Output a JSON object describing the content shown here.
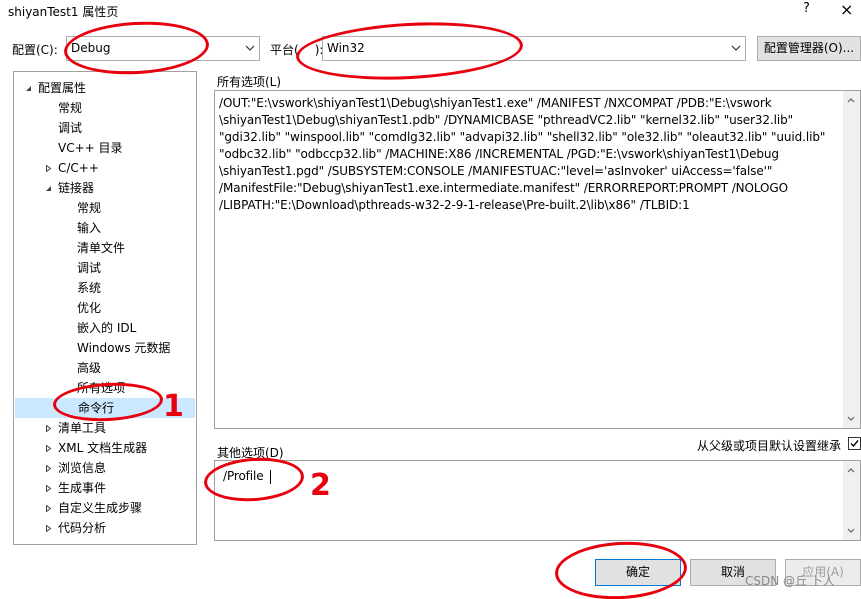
{
  "window": {
    "title": "shiyanTest1 属性页",
    "help": "?",
    "close": "×"
  },
  "config": {
    "label": "配置(C):",
    "value": "Debug",
    "platform_label_pre": "平台(",
    "platform_label_post": "):",
    "platform_value": "Win32",
    "manager_button": "配置管理器(O)..."
  },
  "tree": {
    "items": [
      {
        "label": "配置属性",
        "toggle": "open"
      },
      {
        "label": "常规"
      },
      {
        "label": "调试"
      },
      {
        "label": "VC++ 目录"
      },
      {
        "label": "C/C++",
        "toggle": "closed"
      },
      {
        "label": "链接器",
        "toggle": "open"
      },
      {
        "label": "常规"
      },
      {
        "label": "输入"
      },
      {
        "label": "清单文件"
      },
      {
        "label": "调试"
      },
      {
        "label": "系统"
      },
      {
        "label": "优化"
      },
      {
        "label": "嵌入的 IDL"
      },
      {
        "label": "Windows 元数据"
      },
      {
        "label": "高级"
      },
      {
        "label": "所有选项"
      },
      {
        "label": "命令行",
        "selected": true
      },
      {
        "label": "清单工具",
        "toggle": "closed"
      },
      {
        "label": "XML 文档生成器",
        "toggle": "closed"
      },
      {
        "label": "浏览信息",
        "toggle": "closed"
      },
      {
        "label": "生成事件",
        "toggle": "closed"
      },
      {
        "label": "自定义生成步骤",
        "toggle": "closed"
      },
      {
        "label": "代码分析",
        "toggle": "closed"
      }
    ]
  },
  "all_options": {
    "label": "所有选项(L)",
    "lines": [
      "/OUT:\"E:\\vswork\\shiyanTest1\\Debug\\shiyanTest1.exe\" /MANIFEST /NXCOMPAT /PDB:\"E:\\vswork",
      "\\shiyanTest1\\Debug\\shiyanTest1.pdb\" /DYNAMICBASE \"pthreadVC2.lib\" \"kernel32.lib\" \"user32.lib\"",
      "\"gdi32.lib\" \"winspool.lib\" \"comdlg32.lib\" \"advapi32.lib\" \"shell32.lib\" \"ole32.lib\" \"oleaut32.lib\" \"uuid.lib\"",
      "\"odbc32.lib\" \"odbccp32.lib\" /MACHINE:X86 /INCREMENTAL /PGD:\"E:\\vswork\\shiyanTest1\\Debug",
      "\\shiyanTest1.pgd\" /SUBSYSTEM:CONSOLE /MANIFESTUAC:\"level='asInvoker' uiAccess='false'\"",
      "/ManifestFile:\"Debug\\shiyanTest1.exe.intermediate.manifest\" /ERRORREPORT:PROMPT /NOLOGO",
      "/LIBPATH:\"E:\\Download\\pthreads-w32-2-9-1-release\\Pre-built.2\\lib\\x86\" /TLBID:1"
    ]
  },
  "other_options": {
    "label": "其他选项(D)",
    "value": "/Profile",
    "inherit_label": "从父级或项目默认设置继承"
  },
  "buttons": {
    "ok": "确定",
    "cancel": "取消",
    "apply": "应用(A)"
  },
  "annotations": [
    "1",
    "2"
  ],
  "watermark": "CSDN @丘 卜人"
}
